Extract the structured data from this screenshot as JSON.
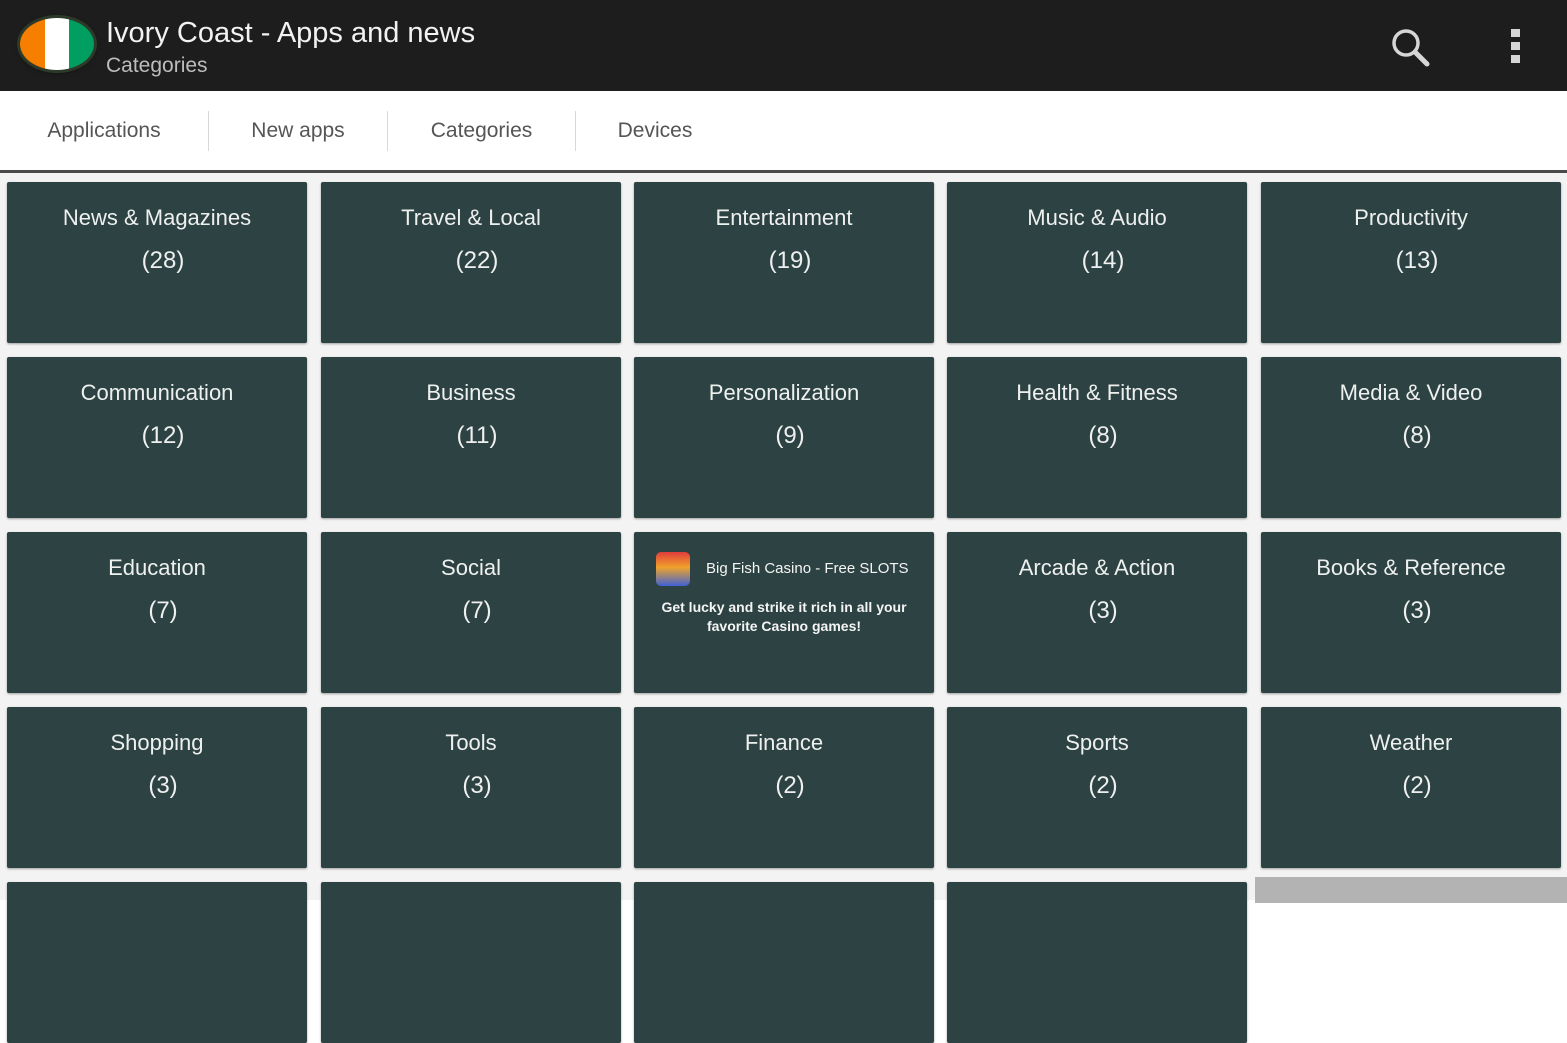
{
  "app": {
    "title": "Ivory Coast - Apps and news",
    "subtitle": "Categories",
    "flag_colors": [
      "#f77f00",
      "#ffffff",
      "#009e60"
    ]
  },
  "toolbar": {
    "search_icon": "search-icon",
    "overflow_icon": "overflow-menu-icon"
  },
  "tabs": [
    {
      "label": "Applications"
    },
    {
      "label": "New apps"
    },
    {
      "label": "Categories"
    },
    {
      "label": "Devices"
    }
  ],
  "categories": [
    {
      "name": "News & Magazines",
      "count": "(28)"
    },
    {
      "name": "Travel & Local",
      "count": "(22)"
    },
    {
      "name": "Entertainment",
      "count": "(19)"
    },
    {
      "name": "Music & Audio",
      "count": "(14)"
    },
    {
      "name": "Productivity",
      "count": "(13)"
    },
    {
      "name": "Communication",
      "count": "(12)"
    },
    {
      "name": "Business",
      "count": "(11)"
    },
    {
      "name": "Personalization",
      "count": "(9)"
    },
    {
      "name": "Health & Fitness",
      "count": "(8)"
    },
    {
      "name": "Media & Video",
      "count": "(8)"
    },
    {
      "name": "Education",
      "count": "(7)"
    },
    {
      "name": "Social",
      "count": "(7)"
    },
    {
      "name": "Arcade & Action",
      "count": "(3)"
    },
    {
      "name": "Books & Reference",
      "count": "(3)"
    },
    {
      "name": "Shopping",
      "count": "(3)"
    },
    {
      "name": "Tools",
      "count": "(3)"
    },
    {
      "name": "Finance",
      "count": "(2)"
    },
    {
      "name": "Sports",
      "count": "(2)"
    },
    {
      "name": "Weather",
      "count": "(2)"
    }
  ],
  "ad": {
    "title": "Big Fish Casino - Free SLOTS",
    "text": "Get lucky and strike it rich in all your favorite Casino games!"
  },
  "colors": {
    "actionbar": "#1d1d1d",
    "tile": "#2d4242",
    "grid_background": "#f3f3f3"
  }
}
